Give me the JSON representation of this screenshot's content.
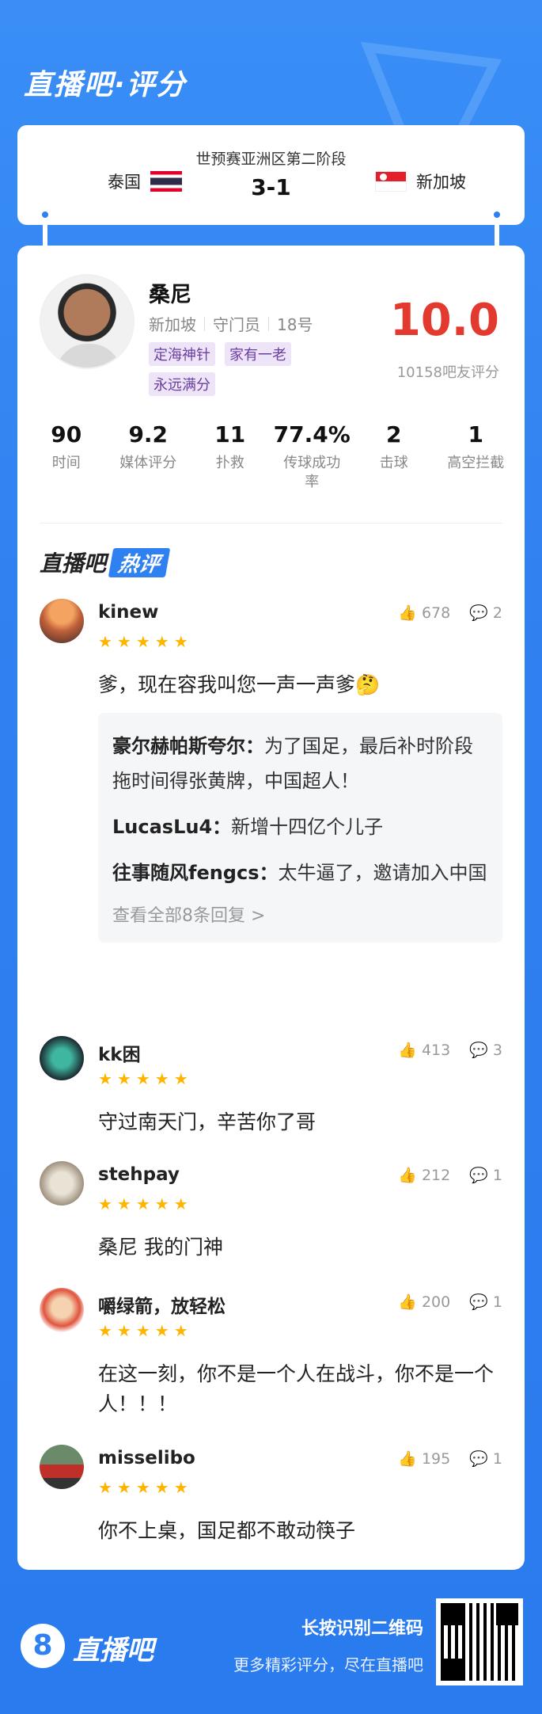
{
  "header": {
    "title": "直播吧·评分"
  },
  "match": {
    "stage": "世预赛亚洲区第二阶段",
    "score": "3-1",
    "home": "泰国",
    "away": "新加坡"
  },
  "player": {
    "name": "桑尼",
    "team": "新加坡",
    "position": "守门员",
    "number": "18号",
    "tags": [
      "定海神针",
      "家有一老",
      "永远满分"
    ],
    "rating": "10.0",
    "votes": "10158吧友评分"
  },
  "stats": [
    {
      "value": "90",
      "label": "时间"
    },
    {
      "value": "9.2",
      "label": "媒体评分"
    },
    {
      "value": "11",
      "label": "扑救"
    },
    {
      "value": "77.4%",
      "label": "传球成功率"
    },
    {
      "value": "2",
      "label": "击球"
    },
    {
      "value": "1",
      "label": "高空拦截"
    }
  ],
  "hot": {
    "brand": "直播吧",
    "label": "热评"
  },
  "comments": [
    {
      "user": "kinew",
      "stars": "★★★★★",
      "likes": "678",
      "replies_count": "2",
      "text": "爹，现在容我叫您一声一声爹🤔",
      "replies": [
        {
          "user": "豪尔赫帕斯夸尔：",
          "text": "为了国足，最后补时阶段拖时间得张黄牌，中国超人！"
        },
        {
          "user": "LucasLu4：",
          "text": "新增十四亿个儿子"
        },
        {
          "user": "往事随风fengcs：",
          "text": "太牛逼了，邀请加入中国"
        }
      ],
      "more": "查看全部8条回复 >"
    },
    {
      "user": "kk困",
      "stars": "★★★★★",
      "likes": "413",
      "replies_count": "3",
      "text": "守过南天门，辛苦你了哥"
    },
    {
      "user": "stehpay",
      "stars": "★★★★★",
      "likes": "212",
      "replies_count": "1",
      "text": "桑尼 我的门神"
    },
    {
      "user": "嚼绿箭，放轻松",
      "stars": "★★★★★",
      "likes": "200",
      "replies_count": "1",
      "text": "在这一刻，你不是一个人在战斗，你不是一个人！！！"
    },
    {
      "user": "misselibo",
      "stars": "★★★★★",
      "likes": "195",
      "replies_count": "1",
      "text": "你不上桌，国足都不敢动筷子"
    }
  ],
  "footer": {
    "logo": "直播吧",
    "logo_mark": "8",
    "line1": "长按识别二维码",
    "line2": "更多精彩评分，尽在直播吧"
  },
  "icons": {
    "like": "thumb-up-icon",
    "reply": "comment-icon"
  },
  "colors": {
    "brand": "#2f80f0",
    "rating": "#e33a2f",
    "tag_bg": "#eee4f7",
    "star": "#ffb400"
  }
}
